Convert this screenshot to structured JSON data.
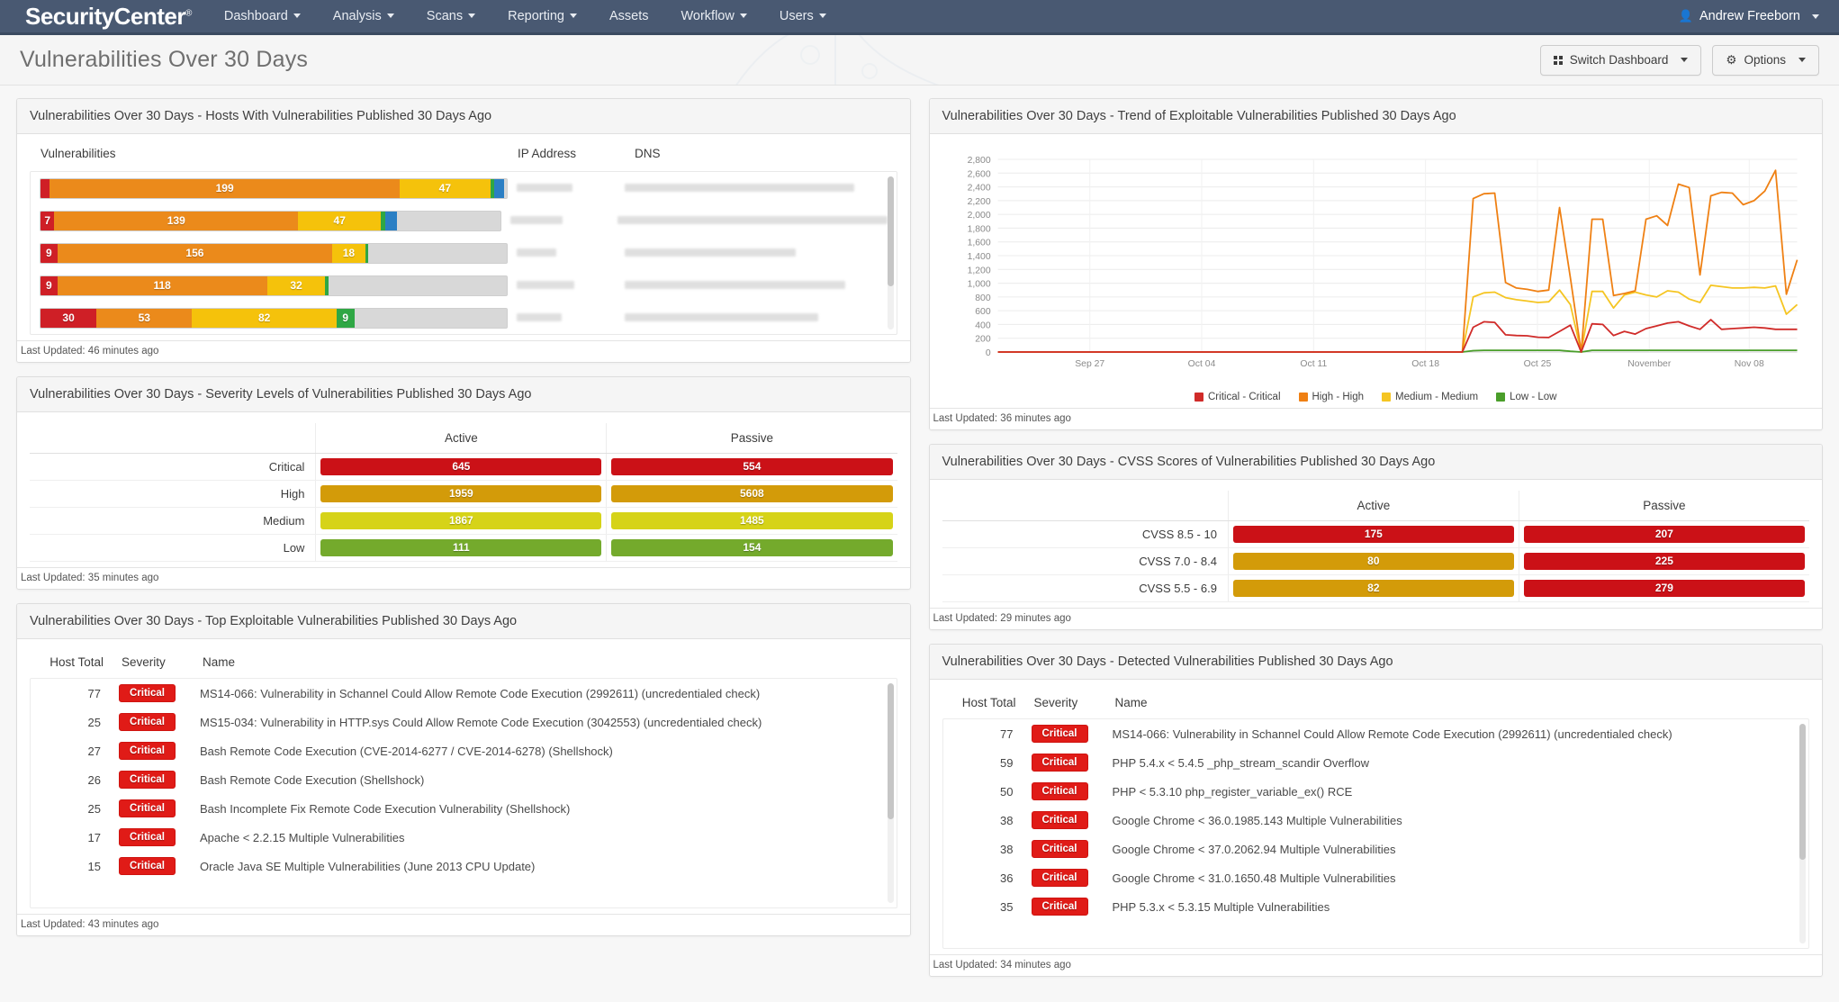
{
  "navbar": {
    "brand": "SecurityCenter",
    "brand_mark": "®",
    "items": [
      {
        "label": "Dashboard",
        "caret": true
      },
      {
        "label": "Analysis",
        "caret": true
      },
      {
        "label": "Scans",
        "caret": true
      },
      {
        "label": "Reporting",
        "caret": true
      },
      {
        "label": "Assets",
        "caret": false
      },
      {
        "label": "Workflow",
        "caret": true
      },
      {
        "label": "Users",
        "caret": true
      }
    ],
    "user": "Andrew Freeborn",
    "user_icon": "user-icon"
  },
  "pagehead": {
    "title": "Vulnerabilities Over 30 Days",
    "switch_dashboard": "Switch Dashboard",
    "options": "Options"
  },
  "panels": {
    "hosts": {
      "title": "Vulnerabilities Over 30 Days - Hosts With Vulnerabilities Published 30 Days Ago",
      "columns": [
        "Vulnerabilities",
        "IP Address",
        "DNS"
      ],
      "rows": [
        {
          "segments": [
            {
              "sev": "crit",
              "label": "",
              "pct": 2.0
            },
            {
              "sev": "high",
              "label": "199",
              "pct": 75.0
            },
            {
              "sev": "med",
              "label": "47",
              "pct": 19.5
            },
            {
              "sev": "low",
              "label": "",
              "pct": 0.8
            },
            {
              "sev": "info",
              "label": "",
              "pct": 2.2
            }
          ],
          "ip_w": 62,
          "dns_w": 255
        },
        {
          "segments": [
            {
              "sev": "crit",
              "label": "7",
              "pct": 3.0
            },
            {
              "sev": "high",
              "label": "139",
              "pct": 53.0
            },
            {
              "sev": "med",
              "label": "47",
              "pct": 18.0
            },
            {
              "sev": "low",
              "label": "",
              "pct": 1.0
            },
            {
              "sev": "info",
              "label": "",
              "pct": 2.4
            }
          ],
          "ip_w": 58,
          "dns_w": 300
        },
        {
          "segments": [
            {
              "sev": "crit",
              "label": "9",
              "pct": 3.6
            },
            {
              "sev": "high",
              "label": "156",
              "pct": 59.0
            },
            {
              "sev": "med",
              "label": "18",
              "pct": 7.0
            },
            {
              "sev": "low",
              "label": "",
              "pct": 0.6
            }
          ],
          "ip_w": 44,
          "dns_w": 190
        },
        {
          "segments": [
            {
              "sev": "crit",
              "label": "9",
              "pct": 3.6
            },
            {
              "sev": "high",
              "label": "118",
              "pct": 45.0
            },
            {
              "sev": "med",
              "label": "32",
              "pct": 12.5
            },
            {
              "sev": "low",
              "label": "",
              "pct": 0.7
            }
          ],
          "ip_w": 64,
          "dns_w": 245
        },
        {
          "segments": [
            {
              "sev": "crit",
              "label": "30",
              "pct": 12.0
            },
            {
              "sev": "high",
              "label": "53",
              "pct": 20.5
            },
            {
              "sev": "med",
              "label": "82",
              "pct": 31.0
            },
            {
              "sev": "low",
              "label": "9",
              "pct": 3.8
            }
          ],
          "ip_w": 50,
          "dns_w": 215
        }
      ],
      "last_updated": "Last Updated: 46 minutes ago"
    },
    "severity": {
      "title": "Vulnerabilities Over 30 Days - Severity Levels of Vulnerabilities Published 30 Days Ago",
      "columns": [
        "",
        "Active",
        "Passive"
      ],
      "rows": [
        {
          "label": "Critical",
          "active": "645",
          "passive": "554",
          "style": "mb-crit"
        },
        {
          "label": "High",
          "active": "1959",
          "passive": "5608",
          "style": "mb-high"
        },
        {
          "label": "Medium",
          "active": "1867",
          "passive": "1485",
          "style": "mb-med"
        },
        {
          "label": "Low",
          "active": "111",
          "passive": "154",
          "style": "mb-low"
        }
      ],
      "last_updated": "Last Updated: 35 minutes ago"
    },
    "top_exploitable": {
      "title": "Vulnerabilities Over 30 Days - Top Exploitable Vulnerabilities Published 30 Days Ago",
      "columns": [
        "Host Total",
        "Severity",
        "Name"
      ],
      "rows": [
        {
          "host_total": "77",
          "severity": "Critical",
          "name": "MS14-066: Vulnerability in Schannel Could Allow Remote Code Execution (2992611) (uncredentialed check)"
        },
        {
          "host_total": "25",
          "severity": "Critical",
          "name": "MS15-034: Vulnerability in HTTP.sys Could Allow Remote Code Execution (3042553) (uncredentialed check)"
        },
        {
          "host_total": "27",
          "severity": "Critical",
          "name": "Bash Remote Code Execution (CVE-2014-6277 / CVE-2014-6278) (Shellshock)"
        },
        {
          "host_total": "26",
          "severity": "Critical",
          "name": "Bash Remote Code Execution (Shellshock)"
        },
        {
          "host_total": "25",
          "severity": "Critical",
          "name": "Bash Incomplete Fix Remote Code Execution Vulnerability (Shellshock)"
        },
        {
          "host_total": "17",
          "severity": "Critical",
          "name": "Apache < 2.2.15 Multiple Vulnerabilities"
        },
        {
          "host_total": "15",
          "severity": "Critical",
          "name": "Oracle Java SE Multiple Vulnerabilities (June 2013 CPU Update)"
        }
      ],
      "last_updated": "Last Updated: 43 minutes ago"
    },
    "trend": {
      "title": "Vulnerabilities Over 30 Days - Trend of Exploitable Vulnerabilities Published 30 Days Ago",
      "last_updated": "Last Updated: 36 minutes ago"
    },
    "cvss": {
      "title": "Vulnerabilities Over 30 Days - CVSS Scores of Vulnerabilities Published 30 Days Ago",
      "columns": [
        "",
        "Active",
        "Passive"
      ],
      "rows": [
        {
          "label": "CVSS 8.5 - 10",
          "active": "175",
          "active_style": "mb-crit",
          "passive": "207",
          "passive_style": "mb-crit"
        },
        {
          "label": "CVSS 7.0 - 8.4",
          "active": "80",
          "active_style": "mb-high",
          "passive": "225",
          "passive_style": "mb-crit"
        },
        {
          "label": "CVSS 5.5 - 6.9",
          "active": "82",
          "active_style": "mb-high",
          "passive": "279",
          "passive_style": "mb-crit"
        }
      ],
      "last_updated": "Last Updated: 29 minutes ago"
    },
    "detected": {
      "title": "Vulnerabilities Over 30 Days - Detected Vulnerabilities Published 30 Days Ago",
      "columns": [
        "Host Total",
        "Severity",
        "Name"
      ],
      "rows": [
        {
          "host_total": "77",
          "severity": "Critical",
          "name": "MS14-066: Vulnerability in Schannel Could Allow Remote Code Execution (2992611) (uncredentialed check)"
        },
        {
          "host_total": "59",
          "severity": "Critical",
          "name": "PHP 5.4.x < 5.4.5 _php_stream_scandir Overflow"
        },
        {
          "host_total": "50",
          "severity": "Critical",
          "name": "PHP < 5.3.10 php_register_variable_ex() RCE"
        },
        {
          "host_total": "38",
          "severity": "Critical",
          "name": "Google Chrome < 36.0.1985.143 Multiple Vulnerabilities"
        },
        {
          "host_total": "38",
          "severity": "Critical",
          "name": "Google Chrome < 37.0.2062.94 Multiple Vulnerabilities"
        },
        {
          "host_total": "36",
          "severity": "Critical",
          "name": "Google Chrome < 31.0.1650.48 Multiple Vulnerabilities"
        },
        {
          "host_total": "35",
          "severity": "Critical",
          "name": "PHP 5.3.x < 5.3.15 Multiple Vulnerabilities"
        }
      ],
      "last_updated": "Last Updated: 34 minutes ago"
    }
  },
  "colors": {
    "critical": "#cf1f26",
    "high": "#eb8a1b",
    "medium": "#f5c20b",
    "low": "#2fa744",
    "info": "#2b7fc4",
    "navbar": "#495972"
  },
  "chart_data": {
    "type": "line",
    "title": "Vulnerabilities Over 30 Days - Trend of Exploitable Vulnerabilities Published 30 Days Ago",
    "xlabel": "",
    "ylabel": "",
    "ylim": [
      0,
      2800
    ],
    "yticks": [
      0,
      200,
      400,
      600,
      800,
      1000,
      1200,
      1400,
      1600,
      1800,
      2000,
      2200,
      2400,
      2600,
      2800
    ],
    "ytick_labels": [
      "0",
      "200",
      "400",
      "600",
      "800",
      "1,000",
      "1,200",
      "1,400",
      "1,600",
      "1,800",
      "2,000",
      "2,200",
      "2,400",
      "2,600",
      "2,800"
    ],
    "xtick_labels": [
      "Sep 27",
      "Oct 04",
      "Oct 11",
      "Oct 18",
      "Oct 25",
      "November",
      "Nov 08"
    ],
    "xtick_positions": [
      0.115,
      0.255,
      0.395,
      0.535,
      0.675,
      0.815,
      0.94
    ],
    "grid": true,
    "legend_position": "bottom",
    "legend": [
      "Critical - Critical",
      "High - High",
      "Medium - Medium",
      "Low - Low"
    ],
    "series": [
      {
        "name": "Critical - Critical",
        "color": "#d02b29",
        "values": [
          0,
          0,
          0,
          0,
          0,
          0,
          0,
          0,
          0,
          0,
          0,
          0,
          0,
          0,
          0,
          0,
          0,
          0,
          0,
          0,
          0,
          0,
          0,
          0,
          0,
          0,
          0,
          0,
          0,
          0,
          0,
          0,
          0,
          0,
          0,
          0,
          0,
          0,
          0,
          0,
          0,
          0,
          0,
          0,
          360,
          440,
          430,
          250,
          240,
          235,
          215,
          210,
          300,
          390,
          0,
          410,
          400,
          240,
          300,
          260,
          340,
          380,
          420,
          440,
          380,
          330,
          470,
          330,
          340,
          350,
          360,
          350,
          330,
          330,
          330
        ]
      },
      {
        "name": "High - High",
        "color": "#ef8013",
        "values": [
          0,
          0,
          0,
          0,
          0,
          0,
          0,
          0,
          0,
          0,
          0,
          0,
          0,
          0,
          0,
          0,
          0,
          0,
          0,
          0,
          0,
          0,
          0,
          0,
          0,
          0,
          0,
          0,
          0,
          0,
          0,
          0,
          0,
          0,
          0,
          0,
          0,
          0,
          0,
          0,
          0,
          0,
          0,
          0,
          2230,
          2300,
          2310,
          1010,
          930,
          910,
          880,
          900,
          2100,
          1080,
          0,
          1930,
          1930,
          820,
          850,
          890,
          1930,
          1980,
          1840,
          2440,
          2390,
          1120,
          2270,
          2320,
          2310,
          2140,
          2200,
          2340,
          2640,
          840,
          1340
        ]
      },
      {
        "name": "Medium - Medium",
        "color": "#f5c522",
        "values": [
          0,
          0,
          0,
          0,
          0,
          0,
          0,
          0,
          0,
          0,
          0,
          0,
          0,
          0,
          0,
          0,
          0,
          0,
          0,
          0,
          0,
          0,
          0,
          0,
          0,
          0,
          0,
          0,
          0,
          0,
          0,
          0,
          0,
          0,
          0,
          0,
          0,
          0,
          0,
          0,
          0,
          0,
          0,
          0,
          800,
          860,
          870,
          790,
          760,
          740,
          720,
          730,
          900,
          690,
          0,
          880,
          880,
          640,
          830,
          870,
          830,
          800,
          890,
          870,
          770,
          720,
          970,
          950,
          930,
          930,
          940,
          930,
          960,
          550,
          690
        ]
      },
      {
        "name": "Low - Low",
        "color": "#4a9e2a",
        "values": [
          0,
          0,
          0,
          0,
          0,
          0,
          0,
          0,
          0,
          0,
          0,
          0,
          0,
          0,
          0,
          0,
          0,
          0,
          0,
          0,
          0,
          0,
          0,
          0,
          0,
          0,
          0,
          0,
          0,
          0,
          0,
          0,
          0,
          0,
          0,
          0,
          0,
          0,
          0,
          0,
          0,
          0,
          0,
          0,
          20,
          25,
          25,
          25,
          25,
          25,
          25,
          25,
          25,
          10,
          0,
          25,
          25,
          25,
          25,
          25,
          25,
          25,
          25,
          25,
          25,
          25,
          25,
          25,
          25,
          25,
          25,
          25,
          25,
          25,
          25
        ]
      }
    ]
  }
}
